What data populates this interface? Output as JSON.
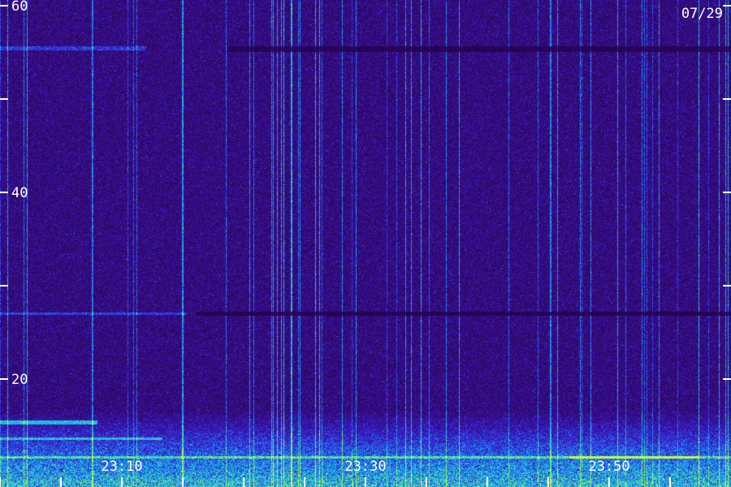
{
  "chart_data": {
    "type": "heatmap",
    "title": "",
    "date_label": "07/29",
    "xlabel": "",
    "ylabel": "",
    "y_ticks": [
      {
        "value": 60,
        "label": "60"
      },
      {
        "value": 50,
        "label": ""
      },
      {
        "value": 40,
        "label": "40"
      },
      {
        "value": 30,
        "label": ""
      },
      {
        "value": 20,
        "label": "20"
      }
    ],
    "ylim": [
      8,
      60
    ],
    "x_ticks": [
      {
        "value": 0,
        "label": ""
      },
      {
        "value": 5,
        "label": ""
      },
      {
        "value": 10,
        "label": "23:10"
      },
      {
        "value": 15,
        "label": ""
      },
      {
        "value": 20,
        "label": ""
      },
      {
        "value": 25,
        "label": ""
      },
      {
        "value": 30,
        "label": "23:30"
      },
      {
        "value": 35,
        "label": ""
      },
      {
        "value": 40,
        "label": ""
      },
      {
        "value": 45,
        "label": ""
      },
      {
        "value": 50,
        "label": "23:50"
      },
      {
        "value": 55,
        "label": ""
      }
    ],
    "xlim": [
      0,
      60
    ],
    "background_color": "#3a0a6e",
    "colormap": [
      "#1a0040",
      "#3a0a6e",
      "#3a1ad0",
      "#1a8cff",
      "#20e0c0",
      "#c8ff40"
    ],
    "features": [
      {
        "name": "horizontal-band",
        "y": 57.5,
        "x_range": [
          0,
          12
        ],
        "intensity": 0.5
      },
      {
        "name": "horizontal-band",
        "y": 31.2,
        "x_range": [
          0,
          15
        ],
        "intensity": 0.5
      },
      {
        "name": "dark-band",
        "y": 31.2,
        "x_range": [
          20,
          60
        ]
      },
      {
        "name": "dark-band",
        "y": 57.3,
        "x_range": [
          20,
          60
        ]
      },
      {
        "name": "low-frequency-noise",
        "y_range": [
          8,
          14
        ],
        "intensity": 0.8
      }
    ]
  }
}
